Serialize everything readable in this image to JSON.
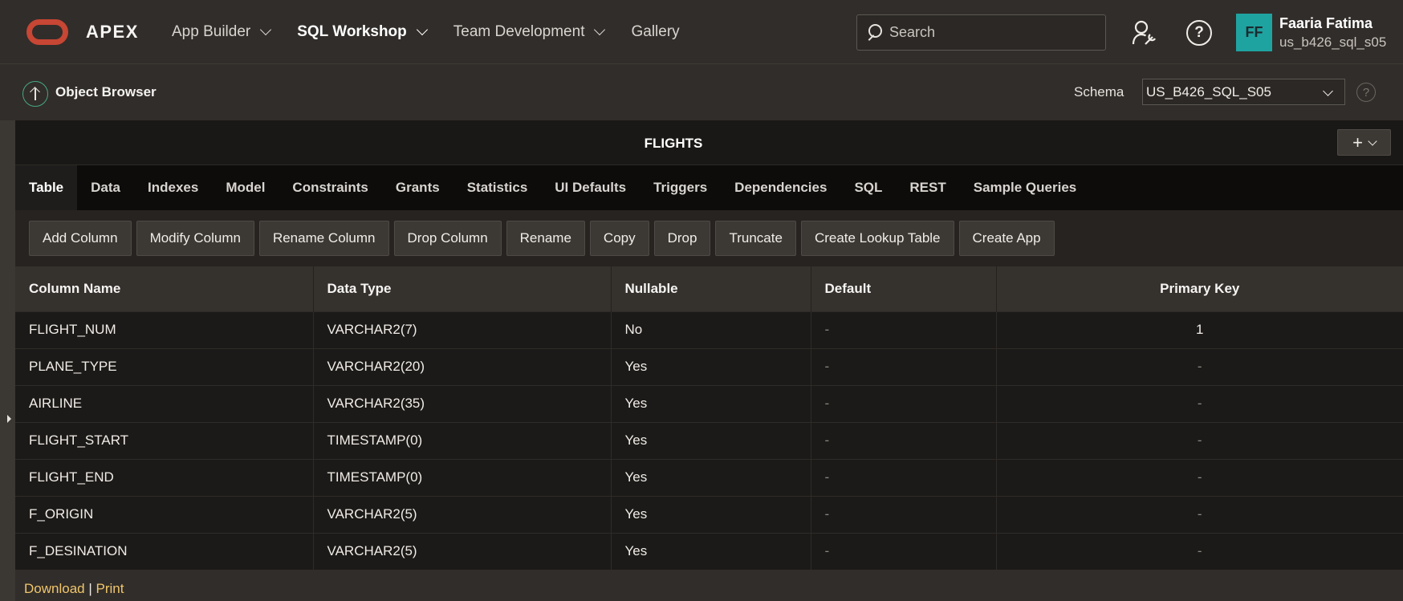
{
  "header": {
    "logo_text": "APEX",
    "nav": [
      {
        "label": "App Builder",
        "has_menu": true
      },
      {
        "label": "SQL Workshop",
        "has_menu": true
      },
      {
        "label": "Team Development",
        "has_menu": true
      },
      {
        "label": "Gallery",
        "has_menu": false
      }
    ],
    "search_placeholder": "Search",
    "help_glyph": "?",
    "user": {
      "initials": "FF",
      "name": "Faaria Fatima",
      "schema": "us_b426_sql_s05"
    }
  },
  "subheader": {
    "title": "Object Browser",
    "schema_label": "Schema",
    "schema_value": "US_B426_SQL_S05",
    "help_glyph": "?"
  },
  "region": {
    "title": "FLIGHTS",
    "add_glyph": "+"
  },
  "tabs": [
    "Table",
    "Data",
    "Indexes",
    "Model",
    "Constraints",
    "Grants",
    "Statistics",
    "UI Defaults",
    "Triggers",
    "Dependencies",
    "SQL",
    "REST",
    "Sample Queries"
  ],
  "active_tab": "Table",
  "toolbar": [
    "Add Column",
    "Modify Column",
    "Rename Column",
    "Drop Column",
    "Rename",
    "Copy",
    "Drop",
    "Truncate",
    "Create Lookup Table",
    "Create App"
  ],
  "table": {
    "columns": [
      "Column Name",
      "Data Type",
      "Nullable",
      "Default",
      "Primary Key"
    ],
    "rows": [
      [
        "FLIGHT_NUM",
        "VARCHAR2(7)",
        "No",
        "-",
        "1"
      ],
      [
        "PLANE_TYPE",
        "VARCHAR2(20)",
        "Yes",
        "-",
        "-"
      ],
      [
        "AIRLINE",
        "VARCHAR2(35)",
        "Yes",
        "-",
        "-"
      ],
      [
        "FLIGHT_START",
        "TIMESTAMP(0)",
        "Yes",
        "-",
        "-"
      ],
      [
        "FLIGHT_END",
        "TIMESTAMP(0)",
        "Yes",
        "-",
        "-"
      ],
      [
        "F_ORIGIN",
        "VARCHAR2(5)",
        "Yes",
        "-",
        "-"
      ],
      [
        "F_DESINATION",
        "VARCHAR2(5)",
        "Yes",
        "-",
        "-"
      ]
    ]
  },
  "footer": {
    "download": "Download",
    "separator": "|",
    "print": "Print"
  },
  "colors": {
    "brand": "#c74634",
    "avatar": "#1fa3a0",
    "link": "#f0c66c"
  }
}
